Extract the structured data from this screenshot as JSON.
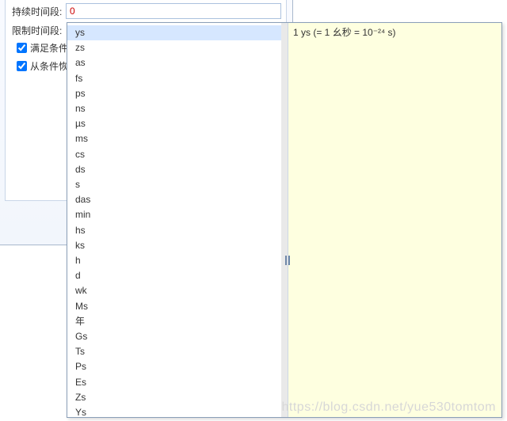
{
  "labels": {
    "duration": "持续时间段:",
    "limit": "限制时间段:",
    "cb1": "满足条件时",
    "cb2": "从条件恢复"
  },
  "input": {
    "value": "0"
  },
  "checks": {
    "c1": true,
    "c2": true
  },
  "units": [
    "ys",
    "zs",
    "as",
    "fs",
    "ps",
    "ns",
    "µs",
    "ms",
    "cs",
    "ds",
    "s",
    "das",
    "min",
    "hs",
    "ks",
    "h",
    "d",
    "wk",
    "Ms",
    "年",
    "Gs",
    "Ts",
    "Ps",
    "Es",
    "Zs",
    "Ys"
  ],
  "selected_index": 0,
  "description": "1 ys (= 1 幺秒 = 10⁻²⁴ s)",
  "watermark": "https://blog.csdn.net/yue530tomtom"
}
